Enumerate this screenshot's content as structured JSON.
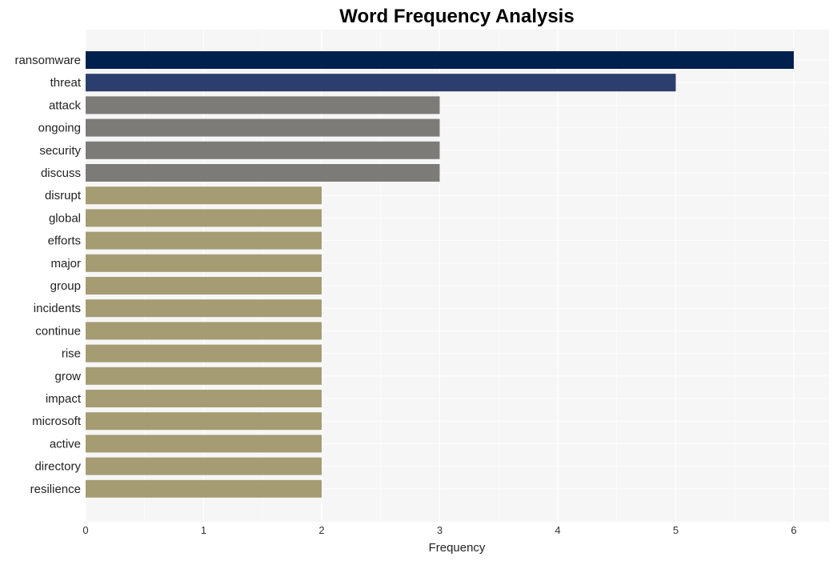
{
  "chart_data": {
    "type": "bar",
    "orientation": "horizontal",
    "title": "Word Frequency Analysis",
    "xlabel": "Frequency",
    "ylabel": "",
    "xlim": [
      0,
      6.3
    ],
    "xticks": [
      0,
      1,
      2,
      3,
      4,
      5,
      6
    ],
    "grid": true,
    "categories": [
      "ransomware",
      "threat",
      "attack",
      "ongoing",
      "security",
      "discuss",
      "disrupt",
      "global",
      "efforts",
      "major",
      "group",
      "incidents",
      "continue",
      "rise",
      "grow",
      "impact",
      "microsoft",
      "active",
      "directory",
      "resilience"
    ],
    "values": [
      6,
      5,
      3,
      3,
      3,
      3,
      2,
      2,
      2,
      2,
      2,
      2,
      2,
      2,
      2,
      2,
      2,
      2,
      2,
      2
    ],
    "colors": [
      "#00204e",
      "#2c3e6d",
      "#7c7b78",
      "#7c7b78",
      "#7c7b78",
      "#7c7b78",
      "#a59c74",
      "#a59c74",
      "#a59c74",
      "#a59c74",
      "#a59c74",
      "#a59c74",
      "#a59c74",
      "#a59c74",
      "#a59c74",
      "#a59c74",
      "#a59c74",
      "#a59c74",
      "#a59c74",
      "#a59c74"
    ]
  }
}
